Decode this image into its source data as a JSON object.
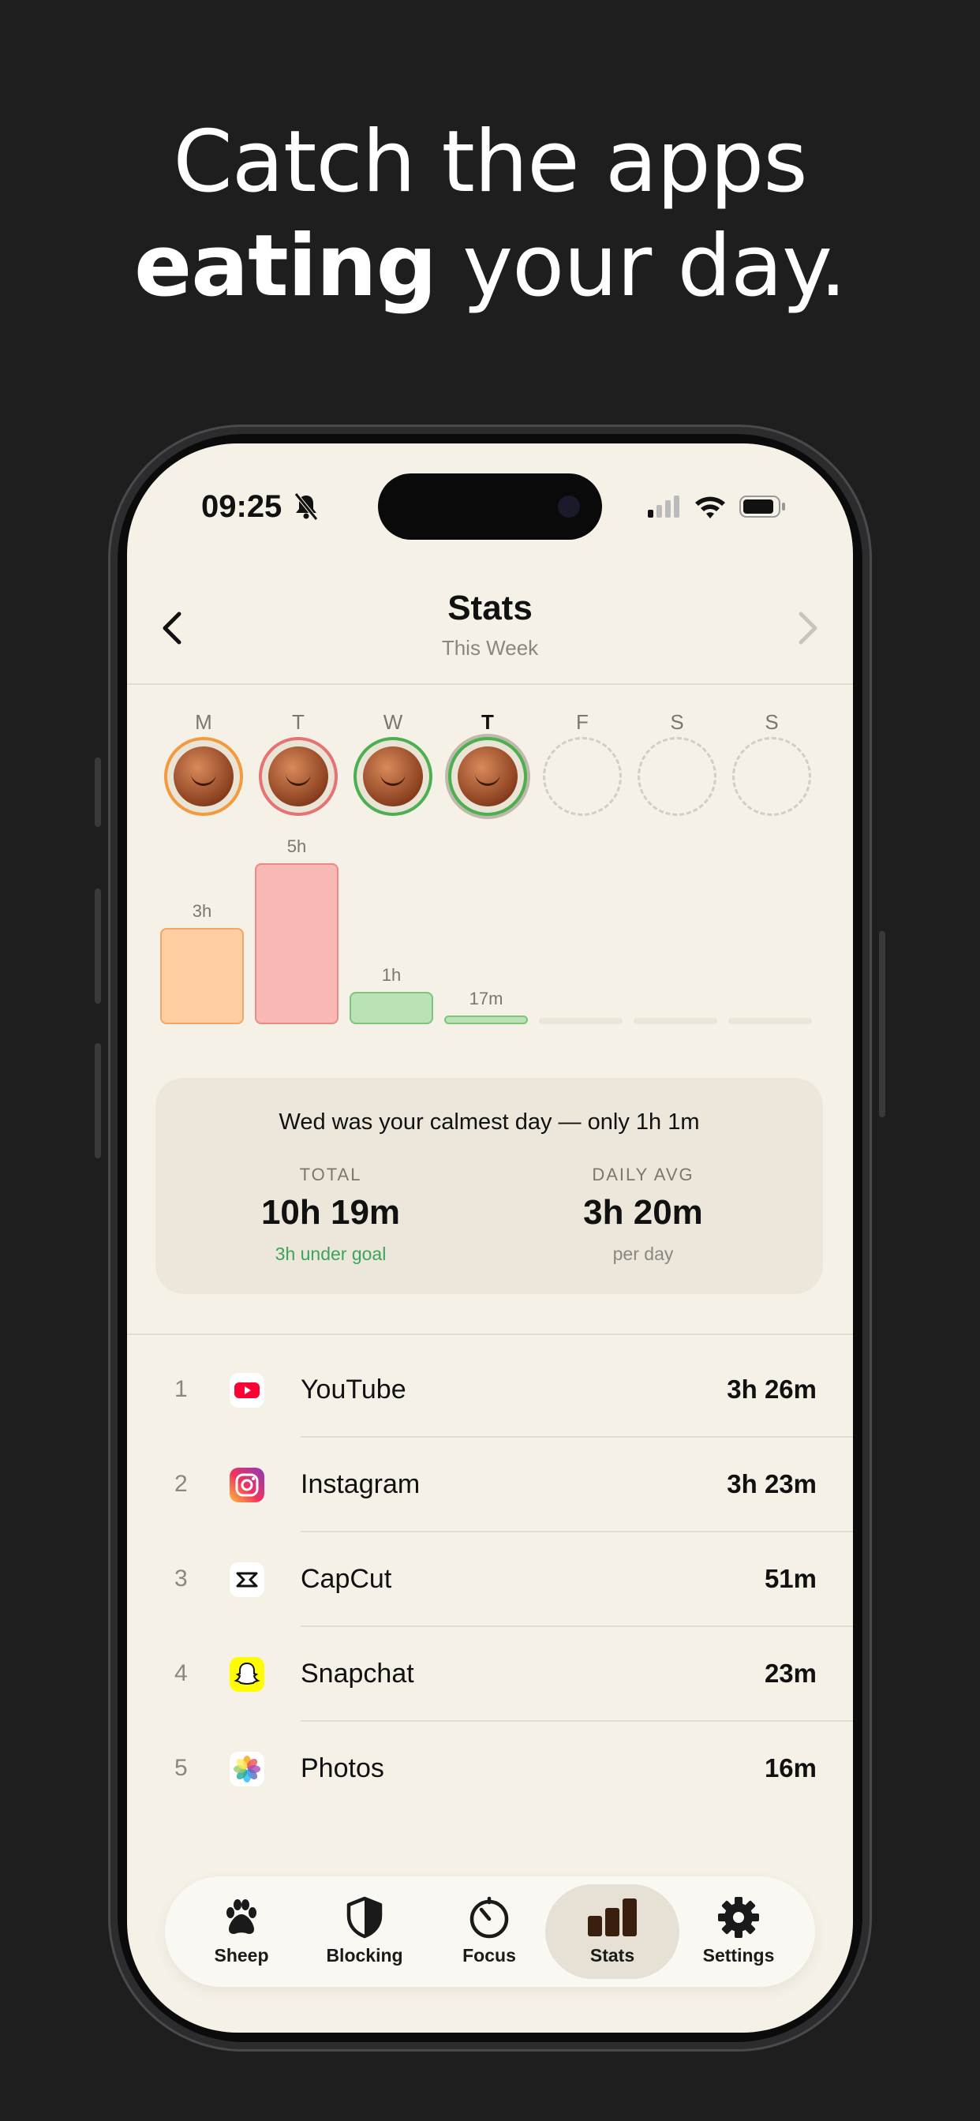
{
  "headline": {
    "line1": "Catch the apps",
    "line2_bold": "eating",
    "line2_rest": " your day."
  },
  "status": {
    "time": "09:25"
  },
  "header": {
    "title": "Stats",
    "subtitle": "This Week"
  },
  "week": [
    {
      "letter": "M",
      "mood": "orange",
      "bar_label": "3h",
      "hours": 3
    },
    {
      "letter": "T",
      "mood": "red",
      "bar_label": "5h",
      "hours": 5
    },
    {
      "letter": "W",
      "mood": "green",
      "bar_label": "1h",
      "hours": 1
    },
    {
      "letter": "T",
      "mood": "today",
      "bar_label": "17m",
      "hours": 0.28
    },
    {
      "letter": "F",
      "mood": "empty",
      "bar_label": "",
      "hours": 0
    },
    {
      "letter": "S",
      "mood": "empty",
      "bar_label": "",
      "hours": 0
    },
    {
      "letter": "S",
      "mood": "empty",
      "bar_label": "",
      "hours": 0
    }
  ],
  "colors": {
    "orange_fill": "#ffcfa3",
    "orange_border": "#f3a563",
    "red_fill": "#f9b8b3",
    "red_border": "#ea8a84",
    "green_fill": "#b9e3b4",
    "green_border": "#7cc57a",
    "empty_fill": "#ebe6da"
  },
  "summary": {
    "headline": "Wed was your calmest day — only 1h 1m",
    "total_label": "TOTAL",
    "total_value": "10h 19m",
    "total_note": "3h under goal",
    "avg_label": "DAILY AVG",
    "avg_value": "3h 20m",
    "avg_note": "per day"
  },
  "apps": [
    {
      "rank": "1",
      "name": "YouTube",
      "time": "3h 26m",
      "icon": "youtube-icon"
    },
    {
      "rank": "2",
      "name": "Instagram",
      "time": "3h 23m",
      "icon": "instagram-icon"
    },
    {
      "rank": "3",
      "name": "CapCut",
      "time": "51m",
      "icon": "capcut-icon"
    },
    {
      "rank": "4",
      "name": "Snapchat",
      "time": "23m",
      "icon": "snapchat-icon"
    },
    {
      "rank": "5",
      "name": "Photos",
      "time": "16m",
      "icon": "photos-icon"
    }
  ],
  "tabs": [
    {
      "label": "Sheep",
      "icon": "paw-icon"
    },
    {
      "label": "Blocking",
      "icon": "shield-icon"
    },
    {
      "label": "Focus",
      "icon": "timer-icon"
    },
    {
      "label": "Stats",
      "icon": "bar-chart-icon",
      "active": true
    },
    {
      "label": "Settings",
      "icon": "gear-icon"
    }
  ]
}
